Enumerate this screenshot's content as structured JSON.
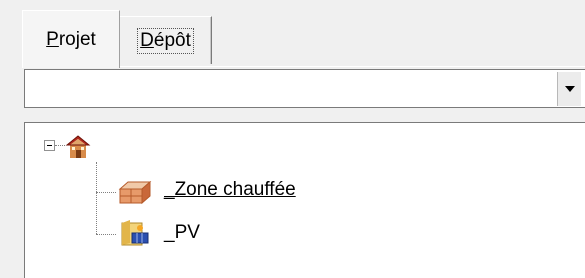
{
  "tabs": [
    {
      "label": "Projet",
      "underline_char": "P",
      "rest": "rojet",
      "active": true
    },
    {
      "label": "Dépôt",
      "underline_char": "D",
      "rest": "épôt",
      "active": false
    }
  ],
  "combo": {
    "value": ""
  },
  "tree": {
    "root": {
      "icon": "house-icon",
      "expanded": true,
      "children": [
        {
          "label": "_Zone chauffée",
          "icon": "heated-zone-icon",
          "underlined": true
        },
        {
          "label": "_PV",
          "icon": "pv-folder-icon",
          "underlined": false
        }
      ]
    }
  }
}
